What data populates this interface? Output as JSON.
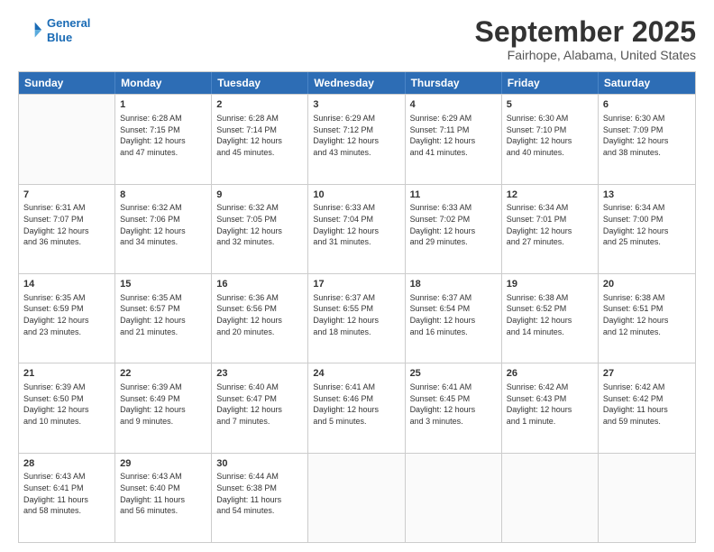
{
  "header": {
    "logo_line1": "General",
    "logo_line2": "Blue",
    "month": "September 2025",
    "location": "Fairhope, Alabama, United States"
  },
  "weekdays": [
    "Sunday",
    "Monday",
    "Tuesday",
    "Wednesday",
    "Thursday",
    "Friday",
    "Saturday"
  ],
  "weeks": [
    [
      {
        "day": "",
        "info": ""
      },
      {
        "day": "1",
        "info": "Sunrise: 6:28 AM\nSunset: 7:15 PM\nDaylight: 12 hours\nand 47 minutes."
      },
      {
        "day": "2",
        "info": "Sunrise: 6:28 AM\nSunset: 7:14 PM\nDaylight: 12 hours\nand 45 minutes."
      },
      {
        "day": "3",
        "info": "Sunrise: 6:29 AM\nSunset: 7:12 PM\nDaylight: 12 hours\nand 43 minutes."
      },
      {
        "day": "4",
        "info": "Sunrise: 6:29 AM\nSunset: 7:11 PM\nDaylight: 12 hours\nand 41 minutes."
      },
      {
        "day": "5",
        "info": "Sunrise: 6:30 AM\nSunset: 7:10 PM\nDaylight: 12 hours\nand 40 minutes."
      },
      {
        "day": "6",
        "info": "Sunrise: 6:30 AM\nSunset: 7:09 PM\nDaylight: 12 hours\nand 38 minutes."
      }
    ],
    [
      {
        "day": "7",
        "info": "Sunrise: 6:31 AM\nSunset: 7:07 PM\nDaylight: 12 hours\nand 36 minutes."
      },
      {
        "day": "8",
        "info": "Sunrise: 6:32 AM\nSunset: 7:06 PM\nDaylight: 12 hours\nand 34 minutes."
      },
      {
        "day": "9",
        "info": "Sunrise: 6:32 AM\nSunset: 7:05 PM\nDaylight: 12 hours\nand 32 minutes."
      },
      {
        "day": "10",
        "info": "Sunrise: 6:33 AM\nSunset: 7:04 PM\nDaylight: 12 hours\nand 31 minutes."
      },
      {
        "day": "11",
        "info": "Sunrise: 6:33 AM\nSunset: 7:02 PM\nDaylight: 12 hours\nand 29 minutes."
      },
      {
        "day": "12",
        "info": "Sunrise: 6:34 AM\nSunset: 7:01 PM\nDaylight: 12 hours\nand 27 minutes."
      },
      {
        "day": "13",
        "info": "Sunrise: 6:34 AM\nSunset: 7:00 PM\nDaylight: 12 hours\nand 25 minutes."
      }
    ],
    [
      {
        "day": "14",
        "info": "Sunrise: 6:35 AM\nSunset: 6:59 PM\nDaylight: 12 hours\nand 23 minutes."
      },
      {
        "day": "15",
        "info": "Sunrise: 6:35 AM\nSunset: 6:57 PM\nDaylight: 12 hours\nand 21 minutes."
      },
      {
        "day": "16",
        "info": "Sunrise: 6:36 AM\nSunset: 6:56 PM\nDaylight: 12 hours\nand 20 minutes."
      },
      {
        "day": "17",
        "info": "Sunrise: 6:37 AM\nSunset: 6:55 PM\nDaylight: 12 hours\nand 18 minutes."
      },
      {
        "day": "18",
        "info": "Sunrise: 6:37 AM\nSunset: 6:54 PM\nDaylight: 12 hours\nand 16 minutes."
      },
      {
        "day": "19",
        "info": "Sunrise: 6:38 AM\nSunset: 6:52 PM\nDaylight: 12 hours\nand 14 minutes."
      },
      {
        "day": "20",
        "info": "Sunrise: 6:38 AM\nSunset: 6:51 PM\nDaylight: 12 hours\nand 12 minutes."
      }
    ],
    [
      {
        "day": "21",
        "info": "Sunrise: 6:39 AM\nSunset: 6:50 PM\nDaylight: 12 hours\nand 10 minutes."
      },
      {
        "day": "22",
        "info": "Sunrise: 6:39 AM\nSunset: 6:49 PM\nDaylight: 12 hours\nand 9 minutes."
      },
      {
        "day": "23",
        "info": "Sunrise: 6:40 AM\nSunset: 6:47 PM\nDaylight: 12 hours\nand 7 minutes."
      },
      {
        "day": "24",
        "info": "Sunrise: 6:41 AM\nSunset: 6:46 PM\nDaylight: 12 hours\nand 5 minutes."
      },
      {
        "day": "25",
        "info": "Sunrise: 6:41 AM\nSunset: 6:45 PM\nDaylight: 12 hours\nand 3 minutes."
      },
      {
        "day": "26",
        "info": "Sunrise: 6:42 AM\nSunset: 6:43 PM\nDaylight: 12 hours\nand 1 minute."
      },
      {
        "day": "27",
        "info": "Sunrise: 6:42 AM\nSunset: 6:42 PM\nDaylight: 11 hours\nand 59 minutes."
      }
    ],
    [
      {
        "day": "28",
        "info": "Sunrise: 6:43 AM\nSunset: 6:41 PM\nDaylight: 11 hours\nand 58 minutes."
      },
      {
        "day": "29",
        "info": "Sunrise: 6:43 AM\nSunset: 6:40 PM\nDaylight: 11 hours\nand 56 minutes."
      },
      {
        "day": "30",
        "info": "Sunrise: 6:44 AM\nSunset: 6:38 PM\nDaylight: 11 hours\nand 54 minutes."
      },
      {
        "day": "",
        "info": ""
      },
      {
        "day": "",
        "info": ""
      },
      {
        "day": "",
        "info": ""
      },
      {
        "day": "",
        "info": ""
      }
    ]
  ]
}
